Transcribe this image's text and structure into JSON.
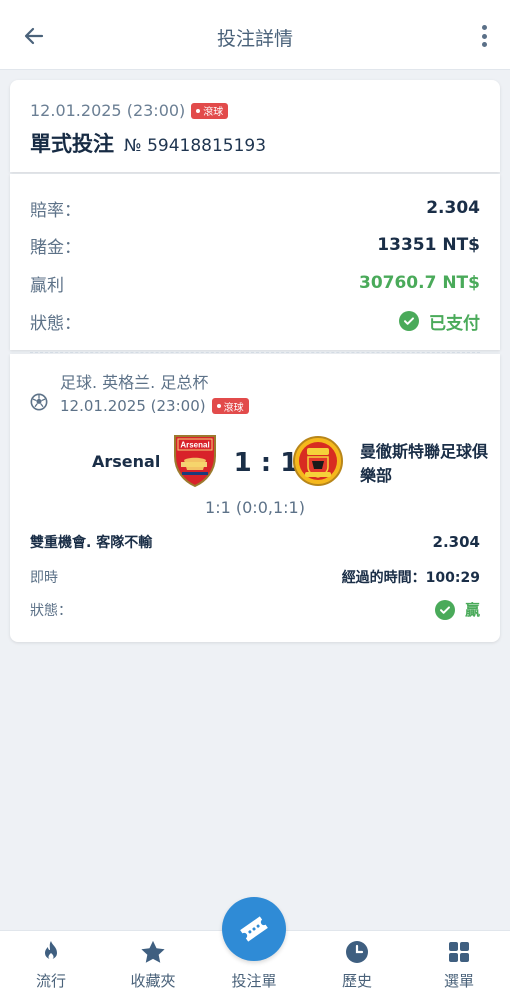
{
  "header": {
    "title": "投注詳情",
    "back_icon": "arrow-left-icon",
    "more_icon": "vertical-dots-icon"
  },
  "bet": {
    "datetime": "12.01.2025 (23:00)",
    "live_label": "滾球",
    "type": "單式投注",
    "number": "№ 59418815193"
  },
  "summary": {
    "odds_label": "賠率：",
    "odds_value": "2.304",
    "stake_label": "賭金：",
    "stake_value": "13351 NT$",
    "win_label": "贏利",
    "win_value": "30760.7 NT$",
    "status_label": "狀態：",
    "status_value": "已支付"
  },
  "match": {
    "sport_path": "足球. 英格兰. 足总杯",
    "datetime": "12.01.2025 (23:00)",
    "live_label": "滾球",
    "home_team": "Arsenal",
    "away_team": "曼徹斯特聯足球俱樂部",
    "score": "1 : 1",
    "score_detail": "1:1 (0:0,1:1)",
    "home_crest_text": "Arsenal",
    "pick": "雙重機會. 客隊不輸",
    "pick_odds": "2.304",
    "live_label_row": "即時",
    "elapsed": "經過的時間：100:29",
    "status_label": "狀態：",
    "status_value": "贏"
  },
  "tabbar": {
    "tabs": [
      {
        "label": "流行",
        "icon": "flame-icon"
      },
      {
        "label": "收藏夾",
        "icon": "star-icon"
      },
      {
        "label": "投注單",
        "icon": "ticket-icon"
      },
      {
        "label": "歷史",
        "icon": "clock-icon"
      },
      {
        "label": "選單",
        "icon": "grid-icon"
      }
    ]
  },
  "colors": {
    "accent": "#2f8bd6",
    "success": "#4aaa5a",
    "live": "#e24b4b",
    "text_dark": "#1a2e47"
  }
}
